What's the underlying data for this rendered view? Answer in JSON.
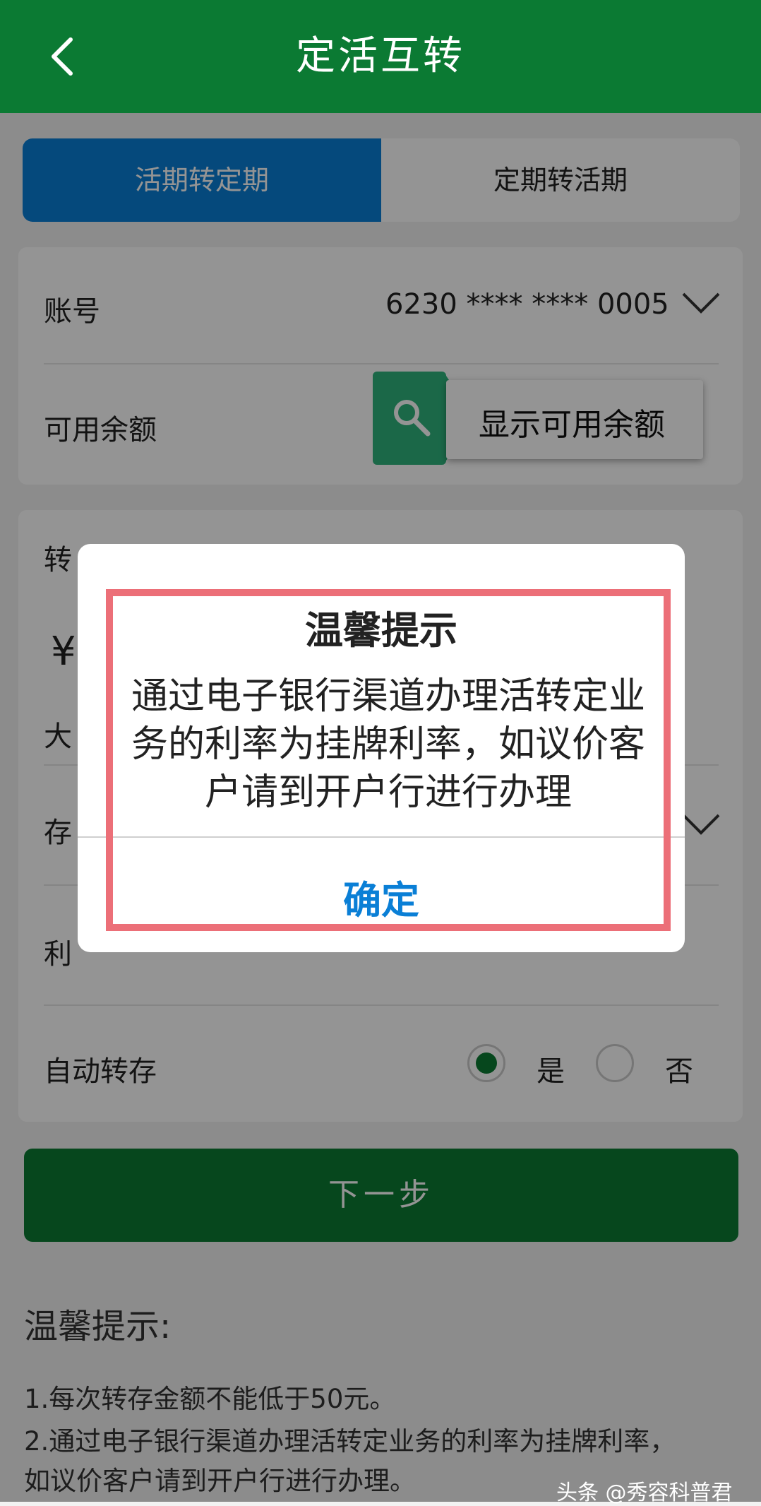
{
  "header": {
    "title": "定活互转"
  },
  "tabs": [
    {
      "label": "活期转定期"
    },
    {
      "label": "定期转活期"
    }
  ],
  "account": {
    "label": "账号",
    "value": "6230 **** **** 0005"
  },
  "balance": {
    "label": "可用余额",
    "show_label": "显示可用余额"
  },
  "amount": {
    "label_partial": "转",
    "currency": "¥",
    "uppercase_partial": "大"
  },
  "term": {
    "label_partial": "存"
  },
  "rate": {
    "label_partial": "利"
  },
  "auto_rollover": {
    "label": "自动转存",
    "options": [
      {
        "label": "是",
        "selected": true
      },
      {
        "label": "否",
        "selected": false
      }
    ]
  },
  "next_button": {
    "label": "下一步"
  },
  "dialog": {
    "title": "温馨提示",
    "body_lines": [
      "通过电子银行渠道办理活转定业",
      "务的利率为挂牌利率，如议价客",
      "户请到开户行进行办理"
    ],
    "confirm": "确定"
  },
  "tips": {
    "title": "温馨提示:",
    "items": [
      "1.每次转存金额不能低于50元。",
      "2.通过电子银行渠道办理活转定业务的利率为挂牌利率，",
      "如议价客户请到开户行进行办理。"
    ]
  },
  "watermark": "头条 @秀容科普君",
  "colors": {
    "header_green": "#0b7a33",
    "tab_blue": "#0a7fd6",
    "tag_green": "#2fb47d",
    "highlight_red": "#ec6f78"
  }
}
